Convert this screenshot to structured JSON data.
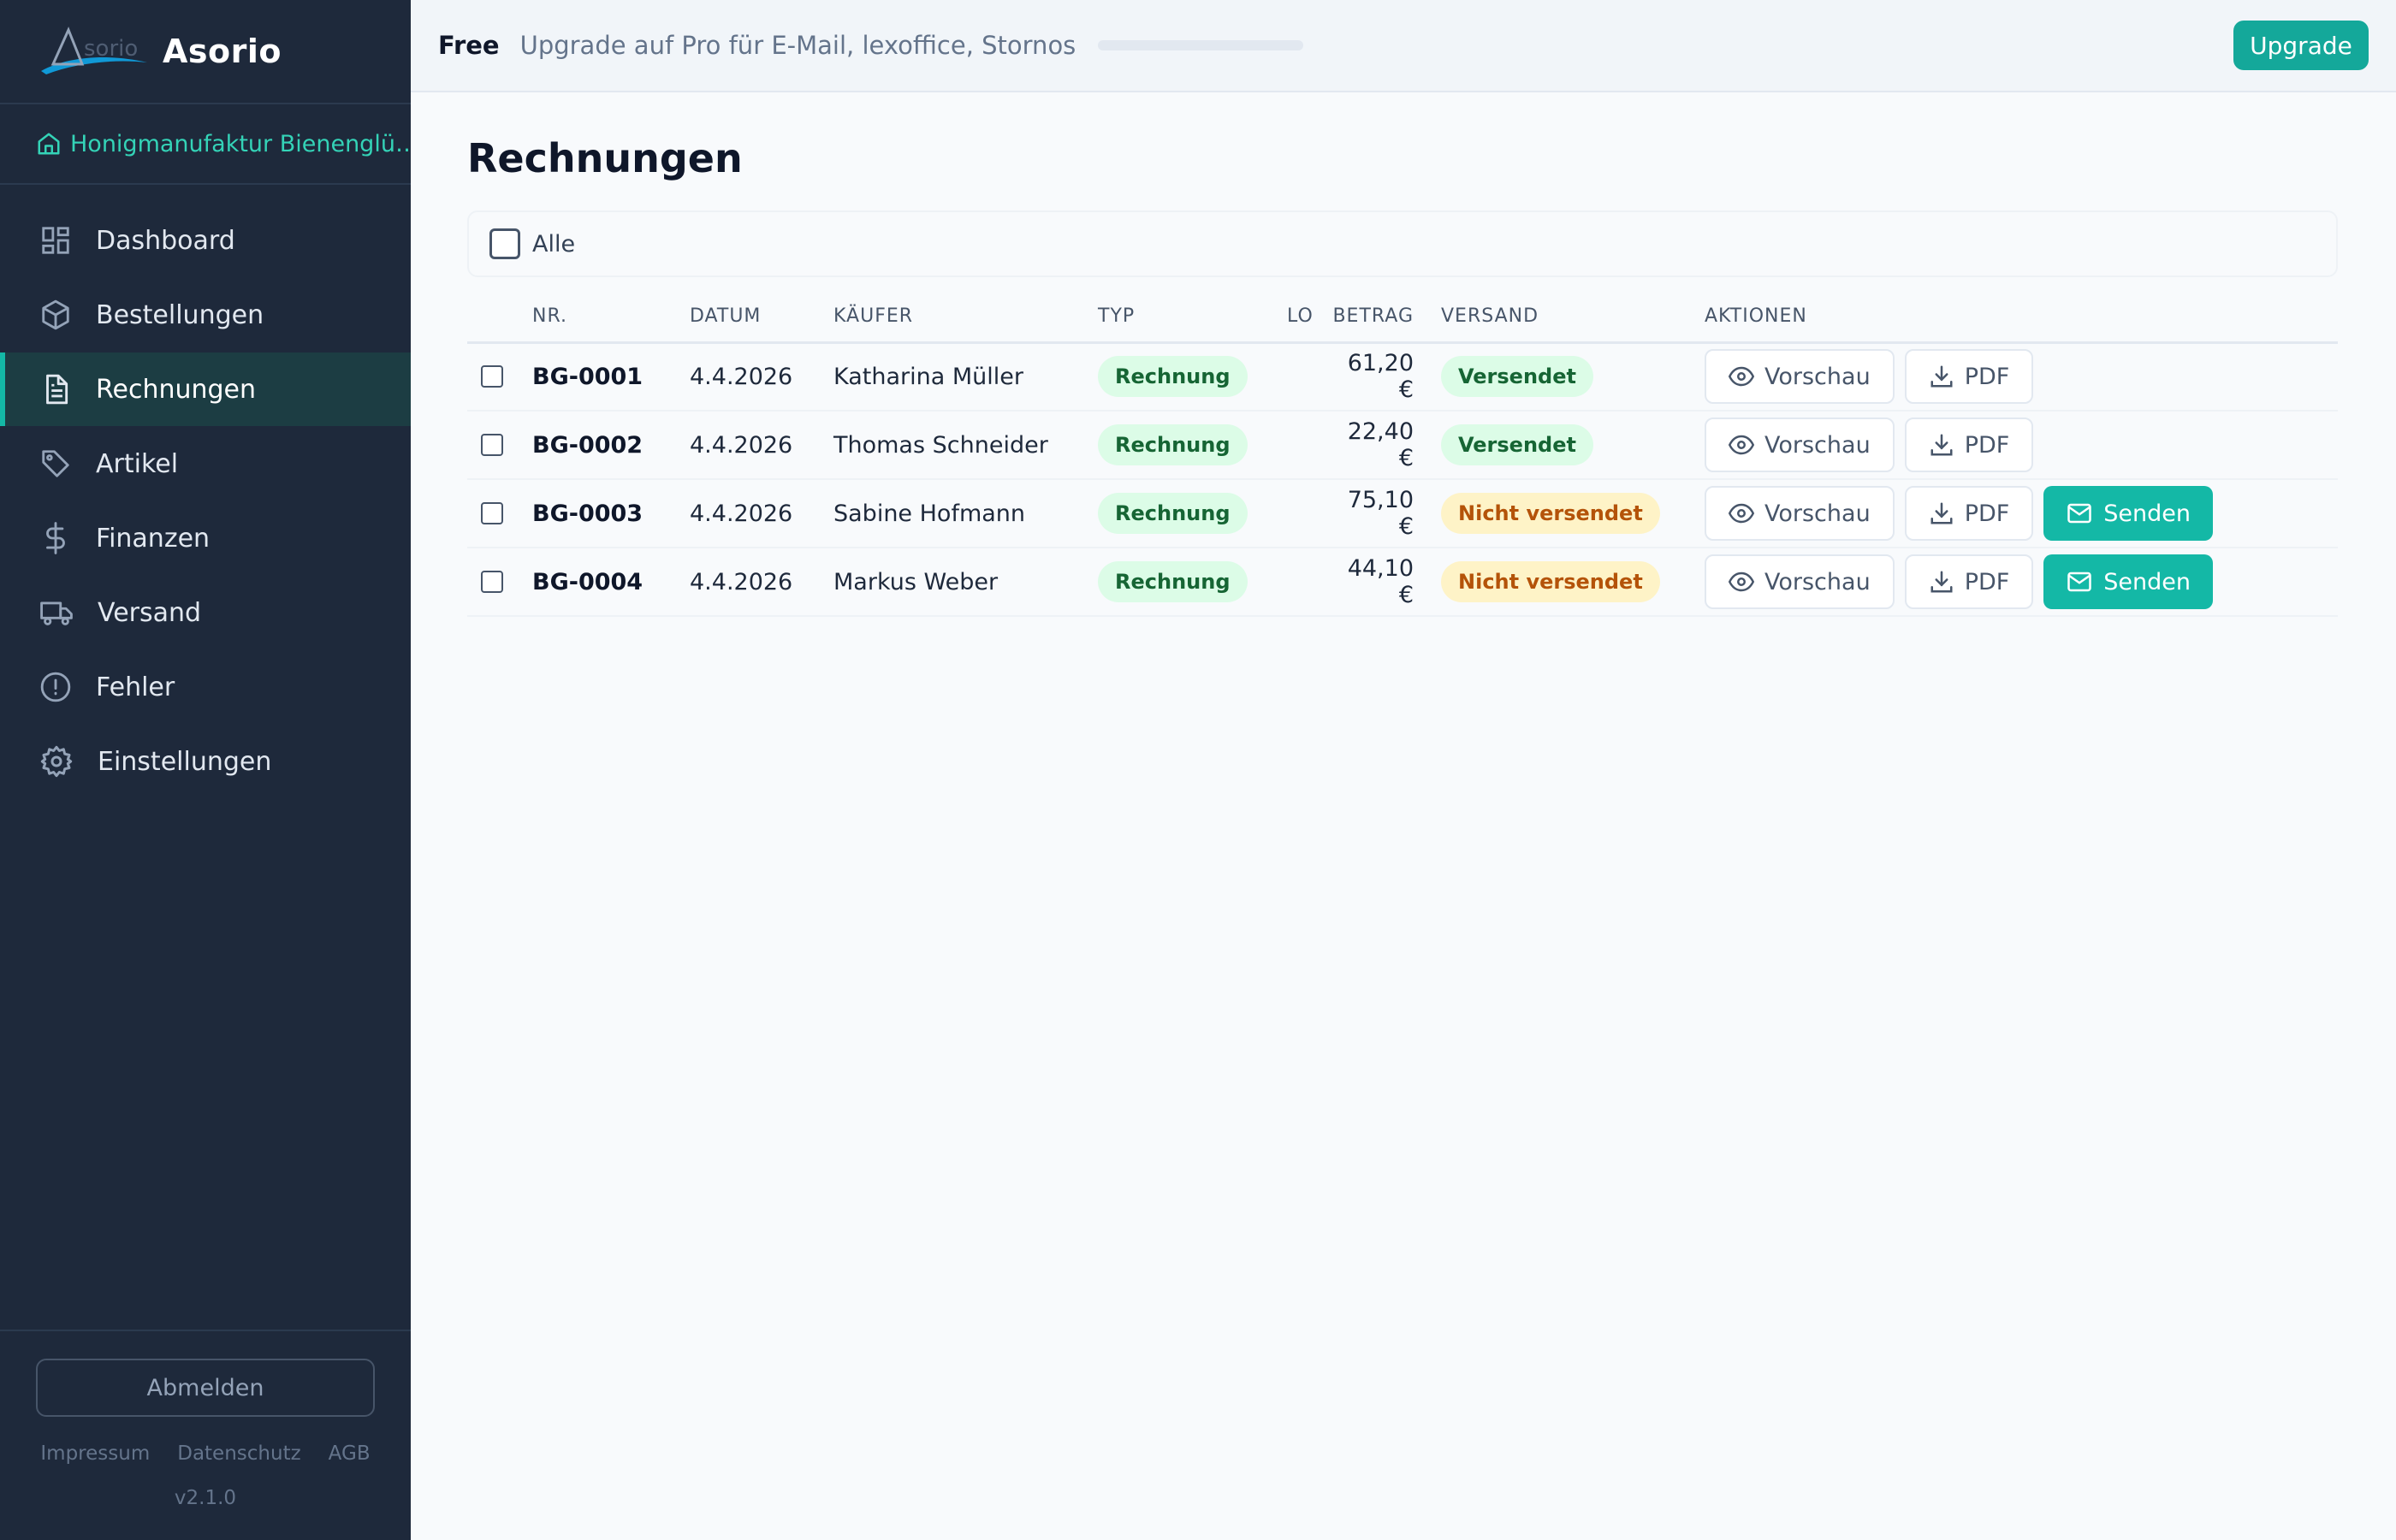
{
  "brand": {
    "logo_text": "Asorio",
    "name": "Asorio"
  },
  "shop": {
    "name": "Honigmanufaktur Bienenglü…"
  },
  "nav": [
    {
      "label": "Dashboard",
      "icon": "dashboard-icon"
    },
    {
      "label": "Bestellungen",
      "icon": "box-icon"
    },
    {
      "label": "Rechnungen",
      "icon": "document-icon",
      "active": true
    },
    {
      "label": "Artikel",
      "icon": "tag-icon"
    },
    {
      "label": "Finanzen",
      "icon": "dollar-icon"
    },
    {
      "label": "Versand",
      "icon": "truck-icon"
    },
    {
      "label": "Fehler",
      "icon": "alert-icon"
    },
    {
      "label": "Einstellungen",
      "icon": "gear-icon"
    }
  ],
  "sidebar_footer": {
    "logout": "Abmelden",
    "links": [
      "Impressum",
      "Datenschutz",
      "AGB"
    ],
    "version": "v2.1.0"
  },
  "topbar": {
    "plan": "Free",
    "upsell": "Upgrade auf Pro für E-Mail, lexoffice, Stornos",
    "usage_fraction": 0.0,
    "upgrade_label": "Upgrade"
  },
  "page": {
    "title": "Rechnungen",
    "select_all_label": "Alle",
    "columns": [
      "NR.",
      "DATUM",
      "KÄUFER",
      "TYP",
      "LO",
      "BETRAG",
      "VERSAND",
      "AKTIONEN"
    ],
    "actions": {
      "preview": "Vorschau",
      "pdf": "PDF",
      "send": "Senden"
    }
  },
  "rows": [
    {
      "nr": "BG-0001",
      "date": "4.4.2026",
      "buyer": "Katharina Müller",
      "type": "Rechnung",
      "lo": "",
      "amount": "61,20 €",
      "shipping": "Versendet",
      "sent": true
    },
    {
      "nr": "BG-0002",
      "date": "4.4.2026",
      "buyer": "Thomas Schneider",
      "type": "Rechnung",
      "lo": "",
      "amount": "22,40 €",
      "shipping": "Versendet",
      "sent": true
    },
    {
      "nr": "BG-0003",
      "date": "4.4.2026",
      "buyer": "Sabine Hofmann",
      "type": "Rechnung",
      "lo": "",
      "amount": "75,10 €",
      "shipping": "Nicht versendet",
      "sent": false
    },
    {
      "nr": "BG-0004",
      "date": "4.4.2026",
      "buyer": "Markus Weber",
      "type": "Rechnung",
      "lo": "",
      "amount": "44,10 €",
      "shipping": "Nicht versendet",
      "sent": false
    }
  ],
  "colors": {
    "accent": "#14b8a6",
    "sidebar": "#1e293b",
    "shop_text": "#34d3b7"
  }
}
